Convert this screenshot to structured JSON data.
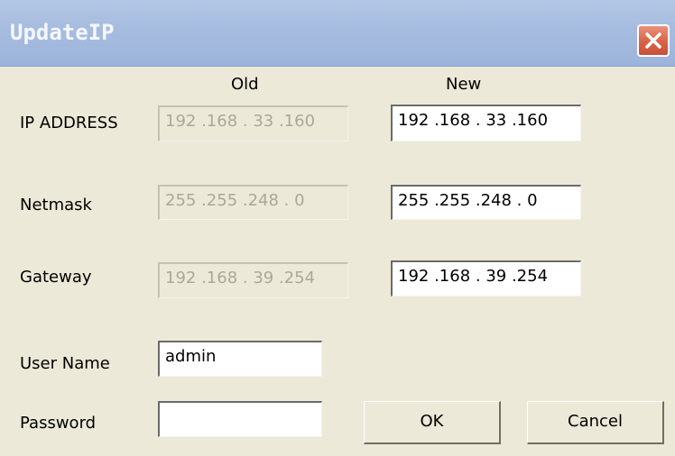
{
  "window": {
    "title": "UpdateIP"
  },
  "columns": {
    "old": "Old",
    "new": "New"
  },
  "rows": [
    {
      "label": "IP ADDRESS",
      "old_value": "192 .168 . 33  .160",
      "new_value": "192 .168 . 33  .160"
    },
    {
      "label": "Netmask",
      "old_value": "255 .255 .248 .  0",
      "new_value": "255 .255 .248 .  0"
    },
    {
      "label": "Gateway",
      "old_value": "192 .168 . 39  .254",
      "new_value": "192 .168 . 39  .254"
    }
  ],
  "credentials": {
    "username_label": "User Name",
    "username_value": "admin",
    "password_label": "Password",
    "password_value": ""
  },
  "buttons": {
    "ok": "OK",
    "cancel": "Cancel"
  },
  "icons": {
    "close": "close-icon"
  },
  "colors": {
    "titlebar": "#a7bde0",
    "close_button": "#d9664a",
    "background": "#ece9d8"
  }
}
